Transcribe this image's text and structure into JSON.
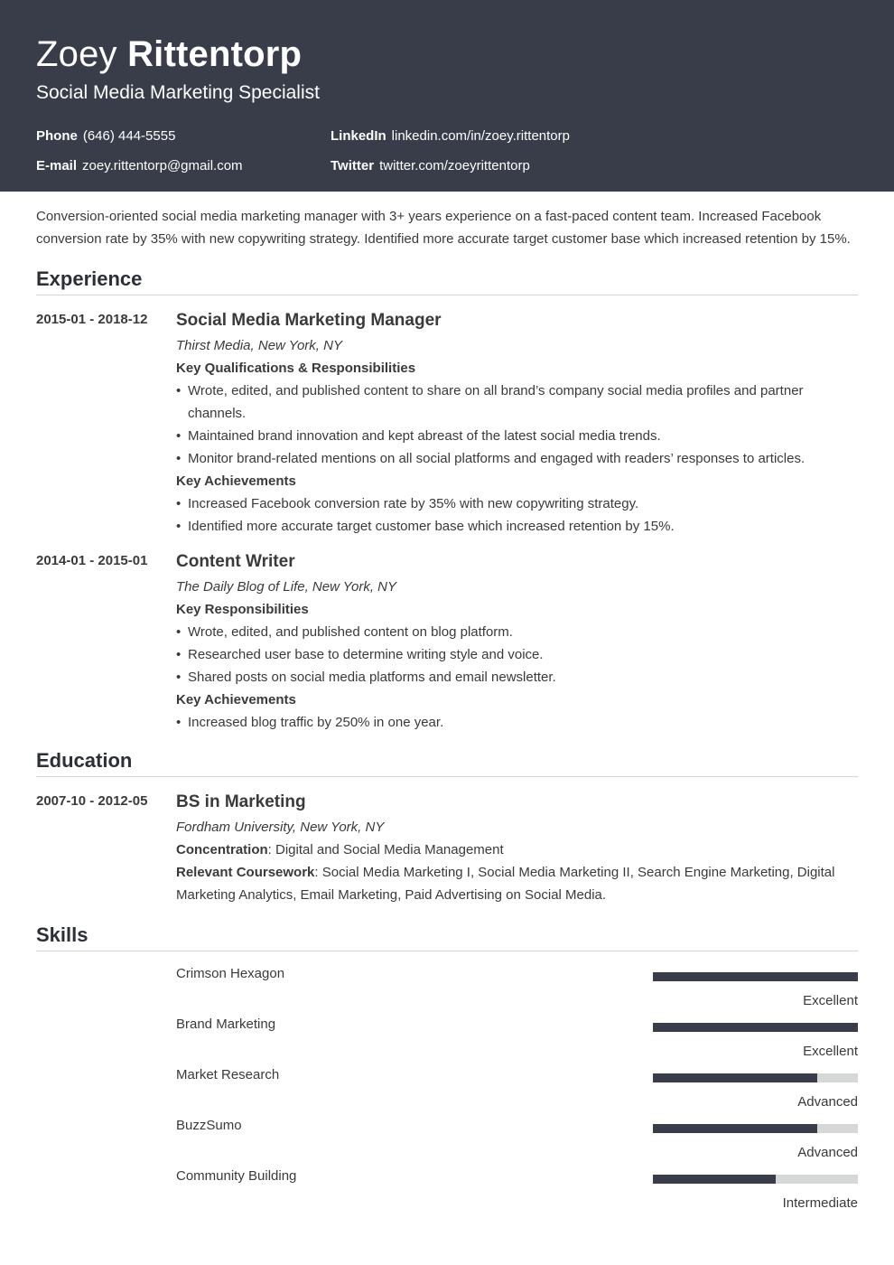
{
  "header": {
    "first_name": "Zoey",
    "last_name": "Rittentorp",
    "title": "Social Media Marketing Specialist",
    "contacts": [
      {
        "label": "Phone",
        "value": "(646) 444-5555"
      },
      {
        "label": "LinkedIn",
        "value": "linkedin.com/in/zoey.rittentorp"
      },
      {
        "label": "E-mail",
        "value": "zoey.rittentorp@gmail.com"
      },
      {
        "label": "Twitter",
        "value": "twitter.com/zoeyrittentorp"
      }
    ]
  },
  "summary": "Conversion-oriented social media marketing manager with 3+ years experience on a fast-paced content team. Increased Facebook conversion rate by 35% with new copywriting strategy. Identified more accurate target customer base which increased retention by 15%.",
  "experience": {
    "heading": "Experience",
    "jobs": [
      {
        "dates": "2015-01 - 2018-12",
        "title": "Social Media Marketing Manager",
        "org": "Thirst Media, New York, NY",
        "groups": [
          {
            "heading": "Key Qualifications & Responsibilities",
            "items": [
              "Wrote, edited, and published content to share on all brand’s company social media profiles and partner channels.",
              "Maintained brand innovation and kept abreast of the latest social media trends.",
              "Monitor brand-related mentions on all social platforms and engaged with readers’ responses to articles."
            ]
          },
          {
            "heading": "Key Achievements",
            "items": [
              "Increased Facebook conversion rate by 35% with new copywriting strategy.",
              "Identified more accurate target customer base which increased retention by 15%."
            ]
          }
        ]
      },
      {
        "dates": "2014-01 - 2015-01",
        "title": "Content Writer",
        "org": "The Daily Blog of Life, New York, NY",
        "groups": [
          {
            "heading": "Key Responsibilities",
            "items": [
              "Wrote, edited, and published content on blog platform.",
              "Researched user base to determine writing style and voice.",
              "Shared posts on social media platforms and email newsletter."
            ]
          },
          {
            "heading": "Key Achievements",
            "items": [
              "Increased blog traffic by 250% in one year."
            ]
          }
        ]
      }
    ]
  },
  "education": {
    "heading": "Education",
    "dates": "2007-10 - 2012-05",
    "degree": "BS in Marketing",
    "school": "Fordham University, New York, NY",
    "concentration_label": "Concentration",
    "concentration": ": Digital and Social Media Management",
    "coursework_label": "Relevant Coursework",
    "coursework": ": Social Media Marketing I, Social Media Marketing II, Search Engine Marketing, Digital Marketing Analytics, Email Marketing, Paid Advertising on Social Media."
  },
  "skills": {
    "heading": "Skills",
    "items": [
      {
        "name": "Crimson Hexagon",
        "level": "Excellent",
        "fraction": 1.0
      },
      {
        "name": "Brand Marketing",
        "level": "Excellent",
        "fraction": 1.0
      },
      {
        "name": "Market Research",
        "level": "Advanced",
        "fraction": 0.8
      },
      {
        "name": "BuzzSumo",
        "level": "Advanced",
        "fraction": 0.8
      },
      {
        "name": "Community Building",
        "level": "Intermediate",
        "fraction": 0.6
      }
    ]
  }
}
